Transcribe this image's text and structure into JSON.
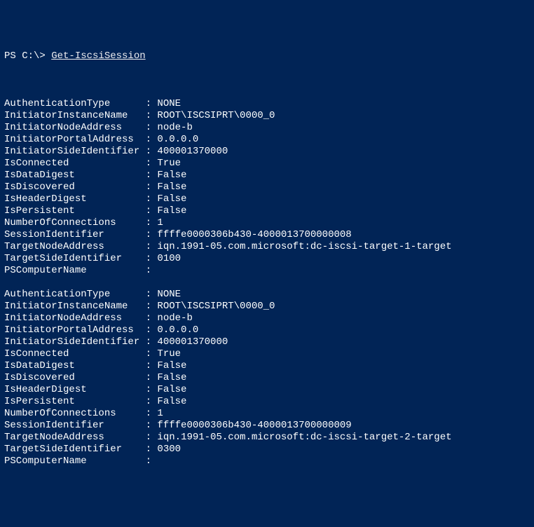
{
  "prompt": "PS C:\\> ",
  "command": "Get-IscsiSession",
  "sessions": [
    {
      "AuthenticationType": "NONE",
      "InitiatorInstanceName": "ROOT\\ISCSIPRT\\0000_0",
      "InitiatorNodeAddress": "node-b",
      "InitiatorPortalAddress": "0.0.0.0",
      "InitiatorSideIdentifier": "400001370000",
      "IsConnected": "True",
      "IsDataDigest": "False",
      "IsDiscovered": "False",
      "IsHeaderDigest": "False",
      "IsPersistent": "False",
      "NumberOfConnections": "1",
      "SessionIdentifier": "ffffe0000306b430-4000013700000008",
      "TargetNodeAddress": "iqn.1991-05.com.microsoft:dc-iscsi-target-1-target",
      "TargetSideIdentifier": "0100",
      "PSComputerName": ""
    },
    {
      "AuthenticationType": "NONE",
      "InitiatorInstanceName": "ROOT\\ISCSIPRT\\0000_0",
      "InitiatorNodeAddress": "node-b",
      "InitiatorPortalAddress": "0.0.0.0",
      "InitiatorSideIdentifier": "400001370000",
      "IsConnected": "True",
      "IsDataDigest": "False",
      "IsDiscovered": "False",
      "IsHeaderDigest": "False",
      "IsPersistent": "False",
      "NumberOfConnections": "1",
      "SessionIdentifier": "ffffe0000306b430-4000013700000009",
      "TargetNodeAddress": "iqn.1991-05.com.microsoft:dc-iscsi-target-2-target",
      "TargetSideIdentifier": "0300",
      "PSComputerName": ""
    }
  ],
  "labelWidth": 24
}
